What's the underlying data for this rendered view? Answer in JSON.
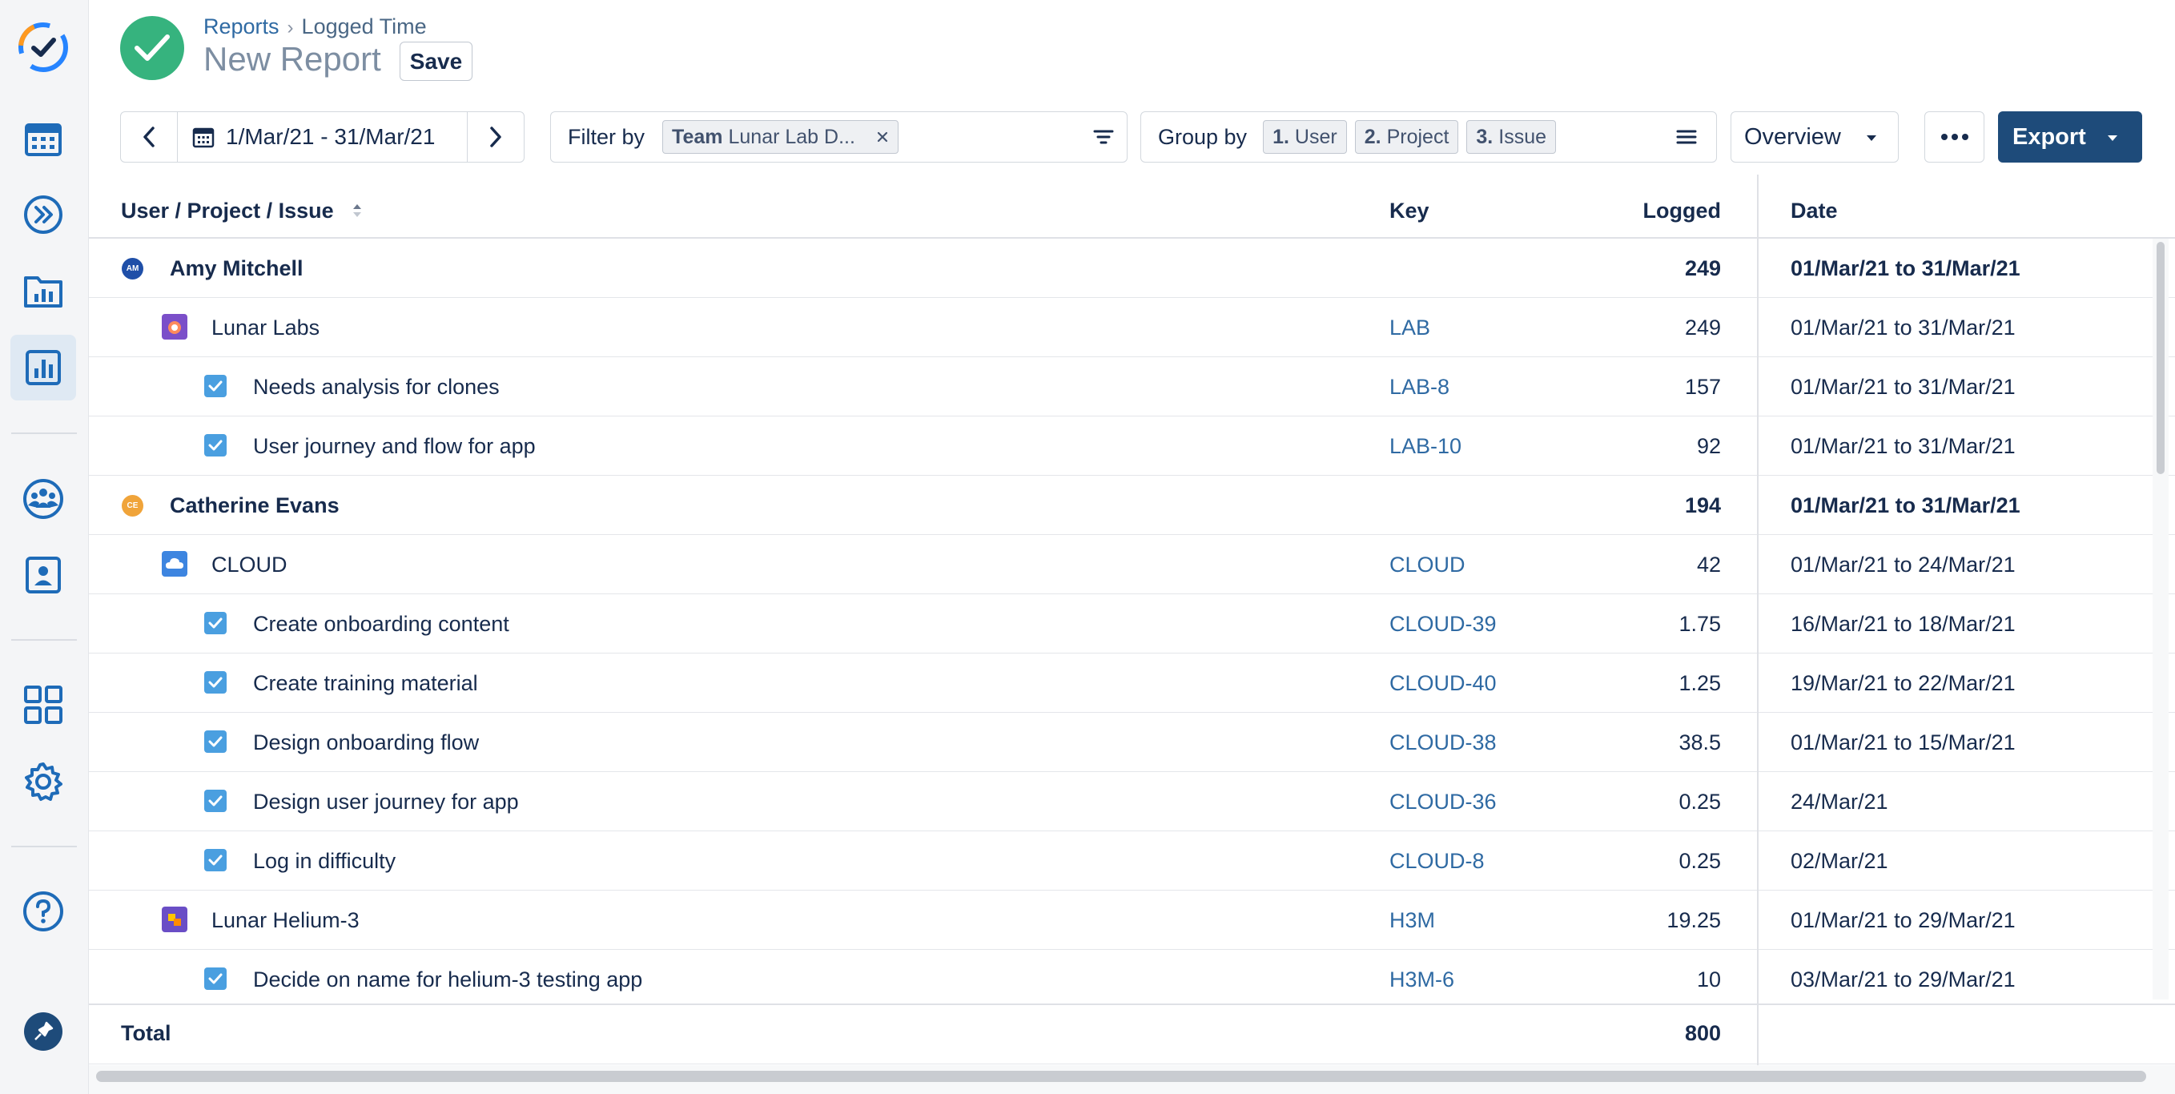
{
  "breadcrumb": {
    "root": "Reports",
    "current": "Logged Time"
  },
  "page": {
    "title": "New Report",
    "save_label": "Save"
  },
  "toolbar": {
    "date_range": "1/Mar/21 - 31/Mar/21",
    "filter_label": "Filter by",
    "filter_chip_key": "Team",
    "filter_chip_value": "Lunar Lab D...",
    "group_label": "Group by",
    "groups": [
      {
        "num": "1.",
        "label": "User"
      },
      {
        "num": "2.",
        "label": "Project"
      },
      {
        "num": "3.",
        "label": "Issue"
      }
    ],
    "view_label": "Overview",
    "export_label": "Export"
  },
  "table": {
    "headers": {
      "name": "User / Project / Issue",
      "key": "Key",
      "logged": "Logged",
      "date": "Date"
    },
    "rows": [
      {
        "level": "user",
        "initials": "AM",
        "name": "Amy Mitchell",
        "key": "",
        "logged": "249",
        "date": "01/Mar/21 to 31/Mar/21"
      },
      {
        "level": "project",
        "name": "Lunar Labs",
        "key": "LAB",
        "logged": "249",
        "date": "01/Mar/21 to 31/Mar/21"
      },
      {
        "level": "issue",
        "name": "Needs analysis for clones",
        "key": "LAB-8",
        "logged": "157",
        "date": "01/Mar/21 to 31/Mar/21"
      },
      {
        "level": "issue",
        "name": "User journey and flow for app",
        "key": "LAB-10",
        "logged": "92",
        "date": "01/Mar/21 to 31/Mar/21"
      },
      {
        "level": "user",
        "initials": "CE",
        "name": "Catherine Evans",
        "key": "",
        "logged": "194",
        "date": "01/Mar/21 to 31/Mar/21"
      },
      {
        "level": "project",
        "name": "CLOUD",
        "key": "CLOUD",
        "logged": "42",
        "date": "01/Mar/21 to 24/Mar/21"
      },
      {
        "level": "issue",
        "name": "Create onboarding content",
        "key": "CLOUD-39",
        "logged": "1.75",
        "date": "16/Mar/21 to 18/Mar/21"
      },
      {
        "level": "issue",
        "name": "Create training material",
        "key": "CLOUD-40",
        "logged": "1.25",
        "date": "19/Mar/21 to 22/Mar/21"
      },
      {
        "level": "issue",
        "name": "Design onboarding flow",
        "key": "CLOUD-38",
        "logged": "38.5",
        "date": "01/Mar/21 to 15/Mar/21"
      },
      {
        "level": "issue",
        "name": "Design user journey for app",
        "key": "CLOUD-36",
        "logged": "0.25",
        "date": "24/Mar/21"
      },
      {
        "level": "issue",
        "name": "Log in difficulty",
        "key": "CLOUD-8",
        "logged": "0.25",
        "date": "02/Mar/21"
      },
      {
        "level": "project",
        "name": "Lunar Helium-3",
        "key": "H3M",
        "logged": "19.25",
        "date": "01/Mar/21 to 29/Mar/21"
      },
      {
        "level": "issue",
        "name": "Decide on name for helium-3 testing app",
        "key": "H3M-6",
        "logged": "10",
        "date": "03/Mar/21 to 29/Mar/21"
      }
    ],
    "total": {
      "label": "Total",
      "logged": "800"
    }
  },
  "colors": {
    "accent": "#1e4b7a",
    "success": "#36b37e",
    "link": "#2f6aa3",
    "issue": "#4a9fe0"
  }
}
